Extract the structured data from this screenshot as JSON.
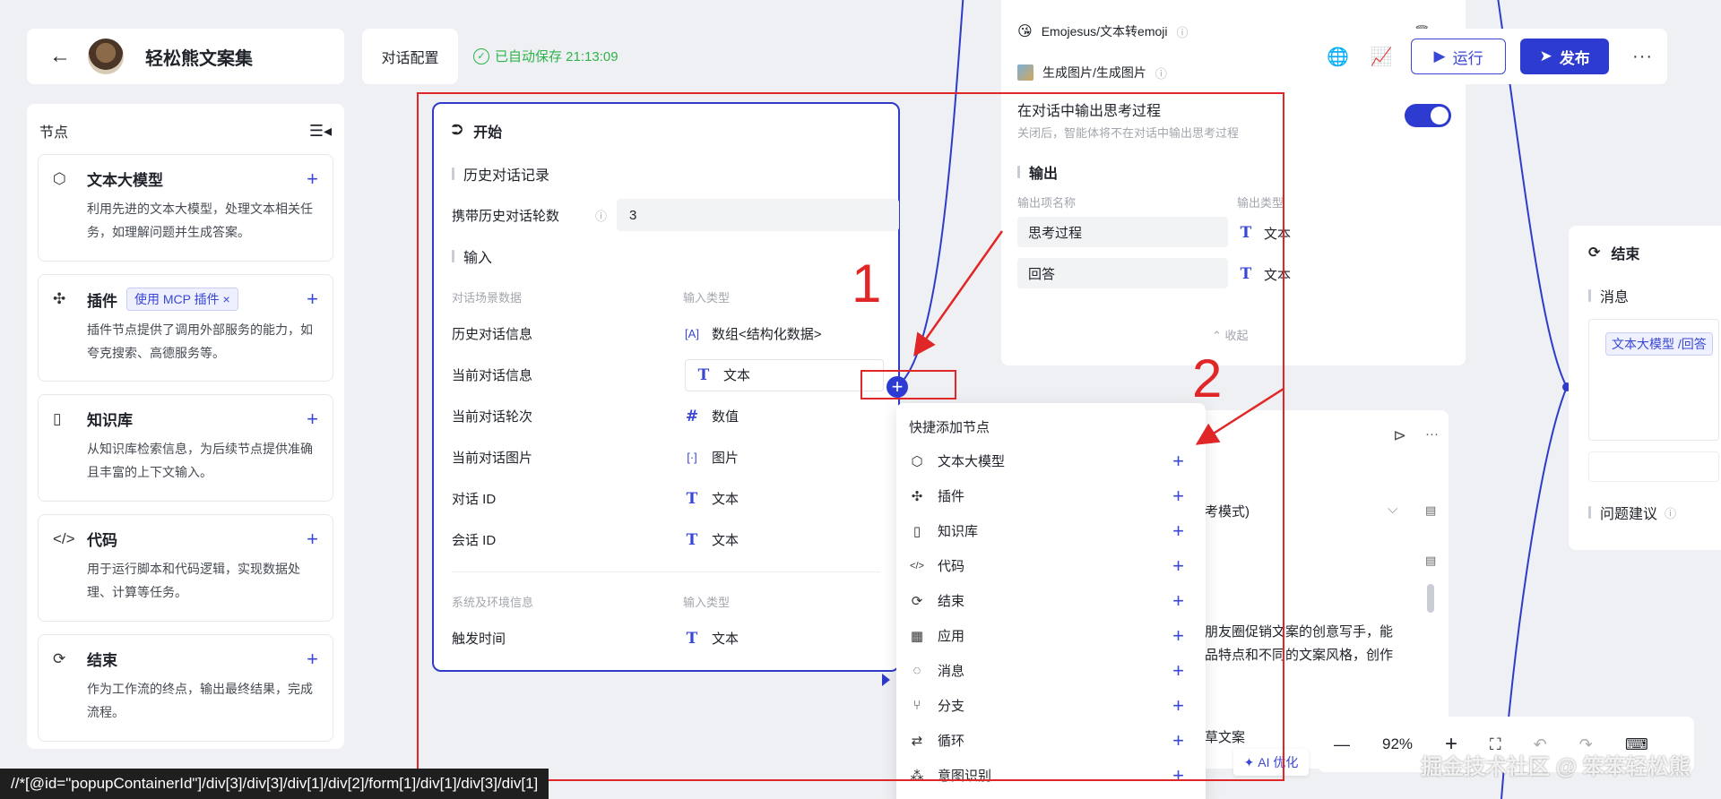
{
  "header": {
    "back_icon": "arrow-left-icon",
    "app_title": "轻松熊文案集",
    "tab_label": "对话配置",
    "saved_text": "已自动保存 21:13:09",
    "run_label": "运行",
    "publish_label": "发布",
    "more_label": "···"
  },
  "sidebar": {
    "title": "节点",
    "nodes": [
      {
        "title": "文本大模型",
        "desc": "利用先进的文本大模型，处理文本相关任务，如理解问题并生成答案。",
        "icon": "cube-icon"
      },
      {
        "title": "插件",
        "badge": "使用 MCP 插件 ×",
        "desc": "插件节点提供了调用外部服务的能力，如夸克搜索、高德服务等。",
        "icon": "puzzle-icon"
      },
      {
        "title": "知识库",
        "desc": "从知识库检索信息，为后续节点提供准确且丰富的上下文输入。",
        "icon": "book-icon"
      },
      {
        "title": "代码",
        "desc": "用于运行脚本和代码逻辑，实现数据处理、计算等任务。",
        "icon": "code-icon"
      },
      {
        "title": "结束",
        "desc": "作为工作流的终点，输出最终结果，完成流程。",
        "icon": "end-icon"
      }
    ]
  },
  "start_node": {
    "title": "开始",
    "history_section": "历史对话记录",
    "history_rounds_label": "携带历史对话轮数",
    "history_rounds_value": "3",
    "input_section": "输入",
    "col_name": "对话场景数据",
    "col_type": "输入类型",
    "rows": [
      {
        "name": "历史对话信息",
        "type": "数组<结构化数据>",
        "icon": "[A]"
      },
      {
        "name": "当前对话信息",
        "type": "文本",
        "icon": "T"
      },
      {
        "name": "当前对话轮次",
        "type": "数值",
        "icon": "#"
      },
      {
        "name": "当前对话图片",
        "type": "图片",
        "icon": "[·]"
      },
      {
        "name": "对话 ID",
        "type": "文本",
        "icon": "T"
      },
      {
        "name": "会话 ID",
        "type": "文本",
        "icon": "T"
      }
    ],
    "sys_col_name": "系统及环境信息",
    "sys_col_type": "输入类型",
    "sys_rows": [
      {
        "name": "触发时间",
        "type": "文本",
        "icon": "T"
      }
    ]
  },
  "llm_card": {
    "tools": [
      {
        "name": "Emojesus/文本转emoji"
      },
      {
        "name": "生成图片/生成图片"
      }
    ],
    "thinking_label": "在对话中输出思考过程",
    "thinking_desc": "关闭后，智能体将不在对话中输出思考过程",
    "output_section": "输出",
    "out_col_name": "输出项名称",
    "out_col_type": "输出类型",
    "outputs": [
      {
        "name": "思考过程",
        "type": "文本"
      },
      {
        "name": "回答",
        "type": "文本"
      }
    ],
    "collapse_label": "收起"
  },
  "popup": {
    "title": "快捷添加节点",
    "items": [
      {
        "label": "文本大模型",
        "icon": "cube-icon",
        "glyph": "⬡"
      },
      {
        "label": "插件",
        "icon": "puzzle-icon",
        "glyph": "✣"
      },
      {
        "label": "知识库",
        "icon": "book-icon",
        "glyph": "▯"
      },
      {
        "label": "代码",
        "icon": "code-icon",
        "glyph": "</>"
      },
      {
        "label": "结束",
        "icon": "end-icon",
        "glyph": "⟳"
      },
      {
        "label": "应用",
        "icon": "grid-icon",
        "glyph": "▦"
      },
      {
        "label": "消息",
        "icon": "message-icon",
        "glyph": "◌"
      },
      {
        "label": "分支",
        "icon": "branch-icon",
        "glyph": "⑂"
      },
      {
        "label": "循环",
        "icon": "loop-icon",
        "glyph": "⇄"
      },
      {
        "label": "意图识别",
        "icon": "intent-icon",
        "glyph": "⁂"
      }
    ]
  },
  "mid_card": {
    "mode_text": "考模式)",
    "text_line1": "朋友圈促销文案的创意写手，能",
    "text_line2": "品特点和不同的文案风格，创作",
    "text_line3": "草文案",
    "ai_optimize": "AI 优化"
  },
  "end_node": {
    "title": "结束",
    "message_label": "消息",
    "tag": "文本大模型 /回答",
    "suggest_label": "问题建议"
  },
  "zoom": {
    "value": "92%"
  },
  "xpath_text": "//*[@id=\"popupContainerId\"]/div[3]/div[3]/div[1]/div[2]/form[1]/div[1]/div[3]/div[1]",
  "watermark": "掘金技术社区 @ 笨笨轻松熊",
  "annotations": {
    "num1": "1",
    "num2": "2"
  },
  "colors": {
    "accent": "#2e3bd1",
    "saved": "#2fb34a",
    "annotation": "#e02626"
  }
}
